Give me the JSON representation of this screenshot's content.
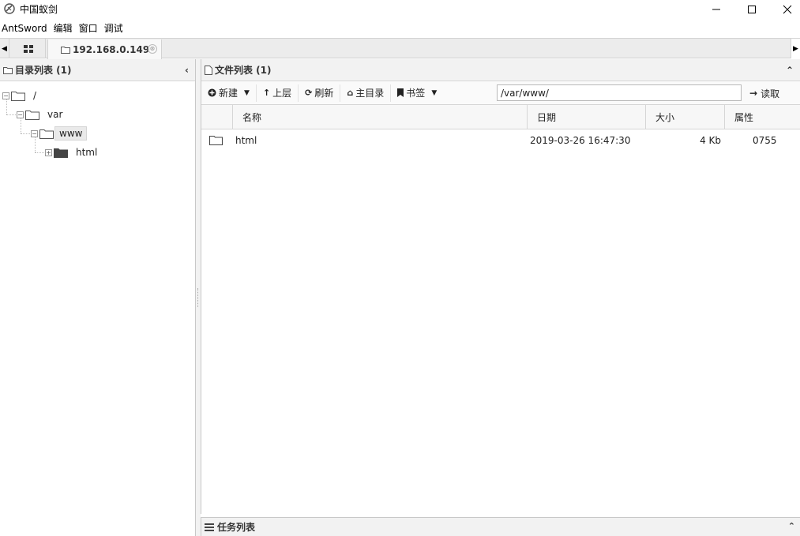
{
  "window": {
    "title": "中国蚁剑",
    "app_icon": "antsword-icon",
    "controls": {
      "minimize": "—",
      "maximize": "☐",
      "close": "✕"
    }
  },
  "menu": {
    "items": [
      "AntSword",
      "编辑",
      "窗口",
      "调试"
    ]
  },
  "tabs": {
    "home_icon": "grid-icon",
    "active_label": "192.168.0.149",
    "close_glyph": "⊗",
    "left_arrow": "◀",
    "right_arrow": "▶"
  },
  "dir_panel": {
    "title": "目录列表 (1)",
    "collapse_glyph": "‹",
    "tree": [
      {
        "label": "/",
        "toggle": "−",
        "icon": "folder-open-icon",
        "depth": 0
      },
      {
        "label": "var",
        "toggle": "−",
        "icon": "folder-open-icon",
        "depth": 1
      },
      {
        "label": "www",
        "toggle": "−",
        "icon": "folder-open-icon",
        "depth": 2,
        "selected": true
      },
      {
        "label": "html",
        "toggle": "+",
        "icon": "folder-closed-icon",
        "depth": 3
      }
    ]
  },
  "file_panel": {
    "title": "文件列表 (1)",
    "collapse_glyph": "⌃",
    "toolbar": {
      "new_label": "新建",
      "up_label": "上层",
      "refresh_label": "刷新",
      "home_label": "主目录",
      "bookmark_label": "书签",
      "path_value": "/var/www/",
      "read_label": "读取"
    },
    "columns": [
      "名称",
      "日期",
      "大小",
      "属性"
    ],
    "rows": [
      {
        "icon": "folder-icon",
        "name": "html",
        "date": "2019-03-26 16:47:30",
        "size": "4 Kb",
        "attr": "0755"
      }
    ]
  },
  "task_panel": {
    "title": "任务列表",
    "collapse_glyph": "⌃"
  }
}
